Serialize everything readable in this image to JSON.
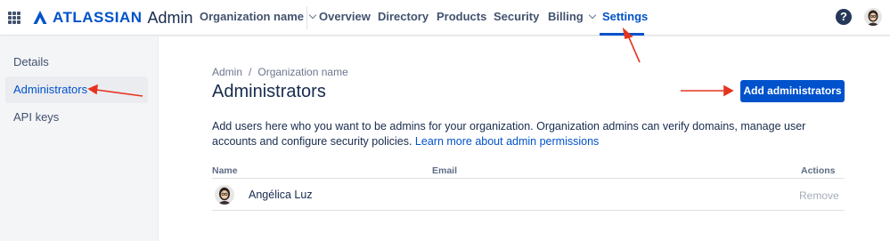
{
  "header": {
    "brand_wordmark": "ATLASSIAN",
    "product_name": "Admin",
    "org_switcher": "Organization name",
    "nav": [
      {
        "label": "Overview"
      },
      {
        "label": "Directory"
      },
      {
        "label": "Products"
      },
      {
        "label": "Security"
      },
      {
        "label": "Billing"
      },
      {
        "label": "Settings"
      }
    ],
    "active_nav": "Settings",
    "help_glyph": "?",
    "icons": [
      "app-switcher-icon",
      "atlassian-logo-icon",
      "chevron-down-icon",
      "help-icon",
      "avatar"
    ]
  },
  "sidebar": {
    "items": [
      {
        "label": "Details"
      },
      {
        "label": "Administrators"
      },
      {
        "label": "API keys"
      }
    ],
    "active_item": "Administrators"
  },
  "main": {
    "breadcrumb": [
      "Admin",
      "Organization name"
    ],
    "breadcrumb_separator": "/",
    "title": "Administrators",
    "primary_button": "Add administrators",
    "description": "Add users here who you want to be admins for your organization. Organization admins can verify domains, manage user accounts and configure security policies.",
    "description_link": "Learn more about admin permissions",
    "table": {
      "columns": [
        "Name",
        "Email",
        "Actions"
      ],
      "rows": [
        {
          "name": "Angélica Luz",
          "email": "",
          "action": "Remove"
        }
      ]
    }
  },
  "colors": {
    "brand_blue": "#0052cc",
    "text_dark": "#172b4d",
    "text_subtle": "#6b778c",
    "sidebar_bg": "#f4f5f7",
    "annotation_red": "#e5341f"
  }
}
